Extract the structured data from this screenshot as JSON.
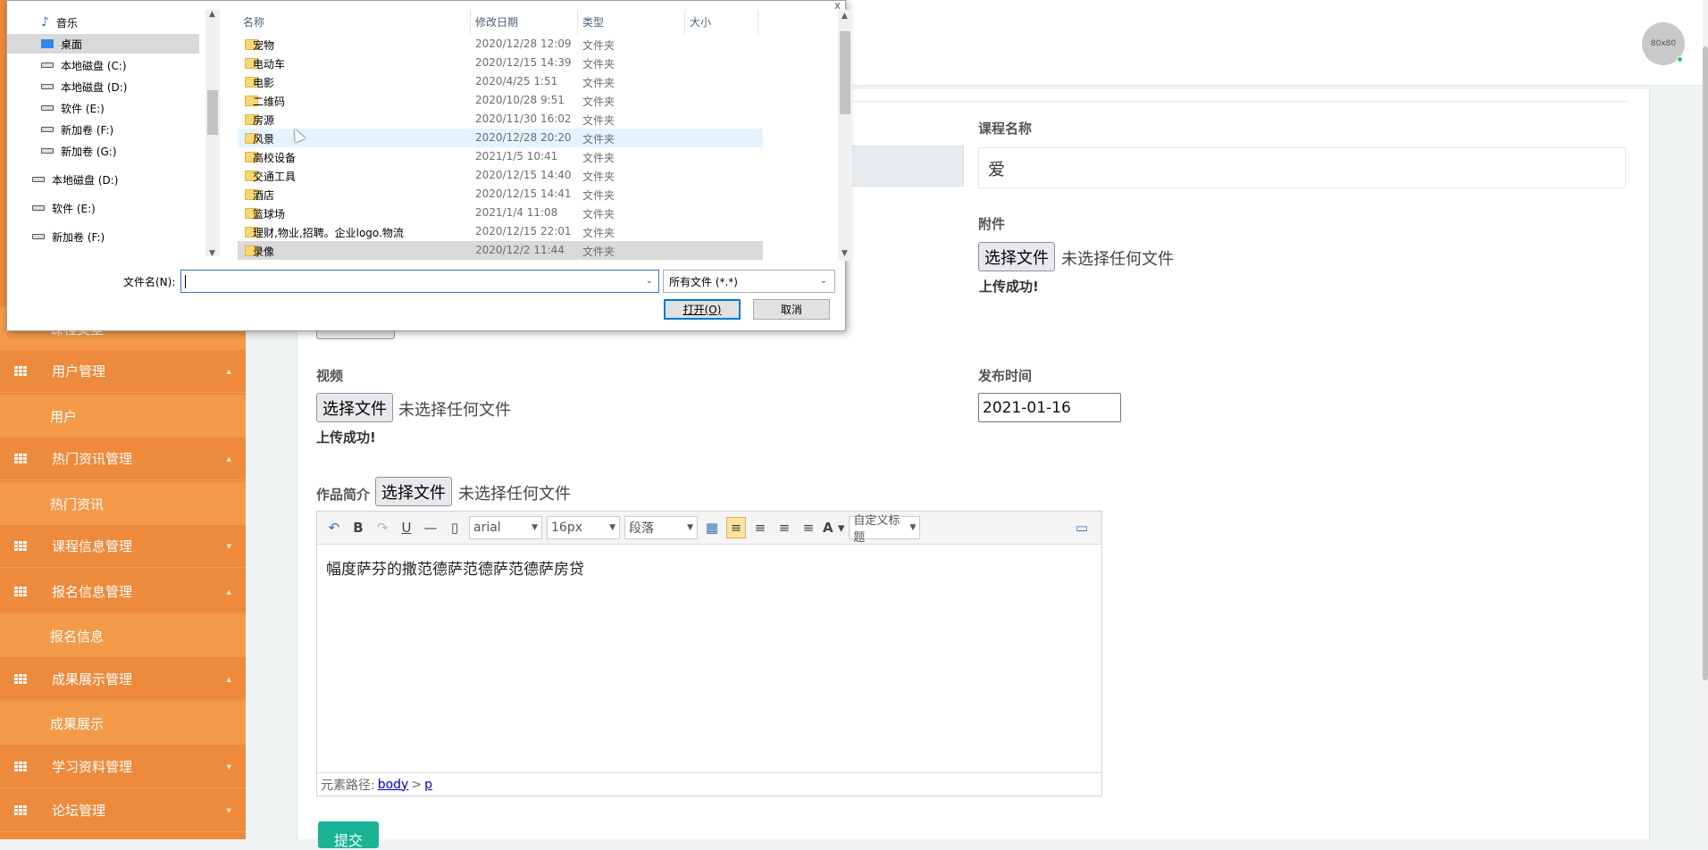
{
  "sidebar": {
    "items": [
      {
        "type": "child",
        "label": "课程类型"
      },
      {
        "type": "parent",
        "label": "用户管理",
        "chevron": "^"
      },
      {
        "type": "child",
        "label": "用户"
      },
      {
        "type": "parent",
        "label": "热门资讯管理",
        "chevron": "^"
      },
      {
        "type": "child",
        "label": "热门资讯"
      },
      {
        "type": "parent",
        "label": "课程信息管理",
        "chevron": "v"
      },
      {
        "type": "parent",
        "label": "报名信息管理",
        "chevron": "^"
      },
      {
        "type": "child",
        "label": "报名信息"
      },
      {
        "type": "parent",
        "label": "成果展示管理",
        "chevron": "^"
      },
      {
        "type": "child",
        "label": "成果展示"
      },
      {
        "type": "parent",
        "label": "学习资料管理",
        "chevron": "v"
      },
      {
        "type": "parent",
        "label": "论坛管理",
        "chevron": "v"
      }
    ]
  },
  "header": {
    "avatar_text": "80x80"
  },
  "form": {
    "course_name_label": "课程名称",
    "course_name_value": "爱",
    "attachment_label": "附件",
    "file_button": "选择文件",
    "no_file": "未选择任何文件",
    "upload_ok": "上传成功!",
    "video_label": "视频",
    "publish_time_label": "发布时间",
    "publish_time_value": "2021-01-16",
    "intro_label": "作品简介",
    "submit_label": "提交"
  },
  "editor": {
    "font_family": "arial",
    "font_size": "16px",
    "paragraph": "段落",
    "custom_title": "自定义标题",
    "content": "幅度萨芬的撒范德萨范德萨范德萨房贷",
    "path_label": "元素路径:",
    "path_body": "body",
    "path_sep": ">",
    "path_p": "p"
  },
  "dialog": {
    "tree": [
      {
        "label": "音乐",
        "icon": "music-icon"
      },
      {
        "label": "桌面",
        "icon": "desktop-icon",
        "selected": true
      },
      {
        "label": "本地磁盘 (C:)",
        "icon": "drive-icon"
      },
      {
        "label": "本地磁盘 (D:)",
        "icon": "drive-icon"
      },
      {
        "label": "软件 (E:)",
        "icon": "drive-icon"
      },
      {
        "label": "新加卷 (F:)",
        "icon": "drive-icon"
      },
      {
        "label": "新加卷 (G:)",
        "icon": "drive-icon"
      },
      {
        "label": "本地磁盘 (D:)",
        "icon": "drive-icon"
      },
      {
        "label": "软件 (E:)",
        "icon": "drive-icon"
      },
      {
        "label": "新加卷 (F:)",
        "icon": "drive-icon"
      }
    ],
    "columns": {
      "name": "名称",
      "modified": "修改日期",
      "type": "类型",
      "size": "大小"
    },
    "files": [
      {
        "name": "宠物",
        "modified": "2020/12/28 12:09",
        "type": "文件夹"
      },
      {
        "name": "电动车",
        "modified": "2020/12/15 14:39",
        "type": "文件夹"
      },
      {
        "name": "电影",
        "modified": "2020/4/25 1:51",
        "type": "文件夹"
      },
      {
        "name": "二维码",
        "modified": "2020/10/28 9:51",
        "type": "文件夹"
      },
      {
        "name": "房源",
        "modified": "2020/11/30 16:02",
        "type": "文件夹"
      },
      {
        "name": "风景",
        "modified": "2020/12/28 20:20",
        "type": "文件夹",
        "hover": true
      },
      {
        "name": "高校设备",
        "modified": "2021/1/5 10:41",
        "type": "文件夹"
      },
      {
        "name": "交通工具",
        "modified": "2020/12/15 14:40",
        "type": "文件夹"
      },
      {
        "name": "酒店",
        "modified": "2020/12/15 14:41",
        "type": "文件夹"
      },
      {
        "name": "篮球场",
        "modified": "2021/1/4 11:08",
        "type": "文件夹"
      },
      {
        "name": "理财,物业,招聘。企业logo.物流",
        "modified": "2020/12/15 22:01",
        "type": "文件夹"
      },
      {
        "name": "录像",
        "modified": "2020/12/2 11:44",
        "type": "文件夹",
        "selected": true
      }
    ],
    "filename_label": "文件名(N):",
    "filename_value": "",
    "filetype": "所有文件 (*.*)",
    "open_label": "打开(O)",
    "cancel_label": "取消"
  }
}
